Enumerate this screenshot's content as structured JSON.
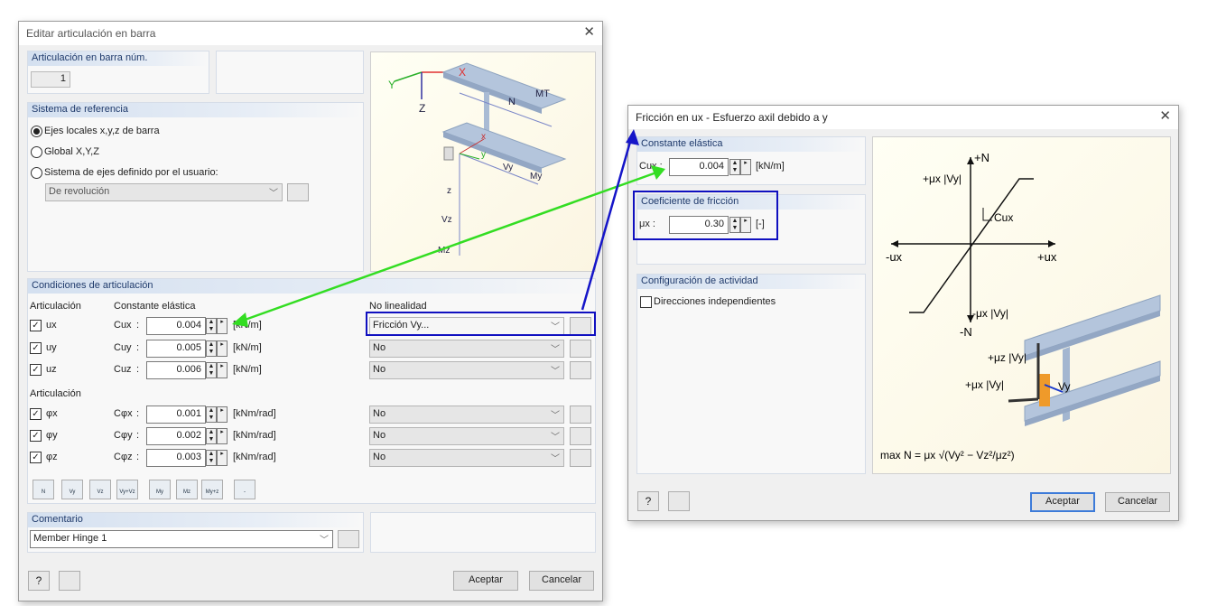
{
  "dialog_main": {
    "title": "Editar articulación en barra",
    "hinge_no_header": "Articulación en barra núm.",
    "hinge_no_value": "1",
    "ref_header": "Sistema de referencia",
    "ref_options": [
      "Ejes locales x,y,z de barra",
      "Global X,Y,Z",
      "Sistema de ejes definido por el usuario:"
    ],
    "ref_combo": "De revolución",
    "cond_header": "Condiciones de articulación",
    "col_hinge": "Articulación",
    "col_spring": "Constante elástica",
    "col_nonlin": "No linealidad",
    "hinge2_label": "Articulación",
    "rows_trans": [
      {
        "name": "ux",
        "const": "Cux",
        "value": "0.004",
        "unit": "[kN/m]",
        "nonlin": "Fricción Vy..."
      },
      {
        "name": "uy",
        "const": "Cuy",
        "value": "0.005",
        "unit": "[kN/m]",
        "nonlin": "No"
      },
      {
        "name": "uz",
        "const": "Cuz",
        "value": "0.006",
        "unit": "[kN/m]",
        "nonlin": "No"
      }
    ],
    "rows_rot": [
      {
        "name": "φx",
        "const": "Cφx",
        "value": "0.001",
        "unit": "[kNm/rad]",
        "nonlin": "No"
      },
      {
        "name": "φy",
        "const": "Cφy",
        "value": "0.002",
        "unit": "[kNm/rad]",
        "nonlin": "No"
      },
      {
        "name": "φz",
        "const": "Cφz",
        "value": "0.003",
        "unit": "[kNm/rad]",
        "nonlin": "No"
      }
    ],
    "toolbar": [
      "N",
      "Vy",
      "Vz",
      "Vy+Vz",
      "My",
      "Mz",
      "My+z",
      "-"
    ],
    "comment_header": "Comentario",
    "comment_value": "Member Hinge 1",
    "ok": "Aceptar",
    "cancel": "Cancelar",
    "diagram_labels": {
      "Y": "Y",
      "X": "X",
      "Z": "Z",
      "N": "N",
      "MT": "MT",
      "x": "x",
      "y": "y",
      "z": "z",
      "Vy": "Vy",
      "My": "My",
      "Vz": "Vz",
      "Mz": "Mz"
    }
  },
  "dialog_friction": {
    "title": "Fricción en ux - Esfuerzo axil debido a y",
    "spring_header": "Constante elástica",
    "spring_label": "Cux :",
    "spring_value": "0.004",
    "spring_unit": "[kN/m]",
    "friction_header": "Coeficiente de fricción",
    "friction_label": "μx :",
    "friction_value": "0.30",
    "friction_unit": "[-]",
    "activity_header": "Configuración de actividad",
    "activity_option": "Direcciones independientes",
    "ok": "Aceptar",
    "cancel": "Cancelar",
    "diagram_labels": {
      "plusN": "+N",
      "minusN": "-N",
      "plusux": "+ux",
      "minusux": "-ux",
      "mu_top": "+μx |Vy|",
      "mu_bottom": "-μx |Vy|",
      "cux": "Cux",
      "muz": "+μz |Vy|",
      "mux": "+μx |Vy|",
      "vy": "Vy",
      "formula": "max N = μx √(Vy² − Vz²/μz²)"
    }
  },
  "colors": {
    "accent": "#3d7bd9",
    "highlight": "#1010c0",
    "arrow_green": "#33dd22",
    "arrow_blue": "#1515c8"
  }
}
